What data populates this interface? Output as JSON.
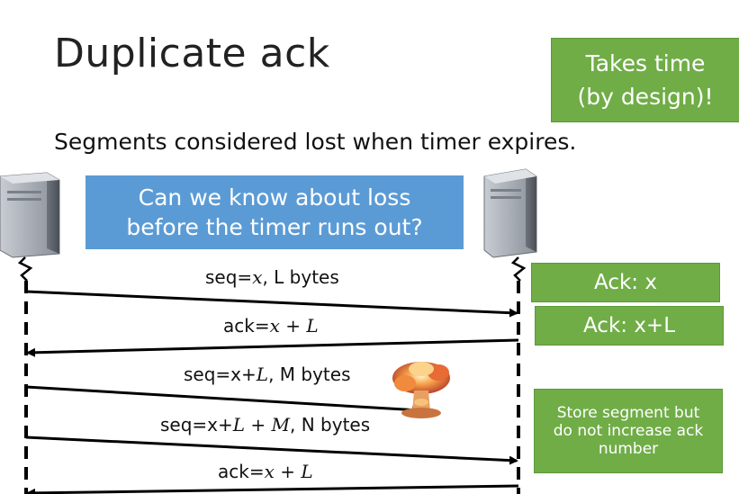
{
  "title": "Duplicate ack",
  "subtitle": "Segments considered lost when timer expires.",
  "callout_top": {
    "line1": "Takes time",
    "line2": "(by design)!"
  },
  "question_box": {
    "line1": "Can we know about loss",
    "line2": "before the timer runs out?"
  },
  "messages": [
    {
      "pre": "seq=",
      "var": "x",
      "post": ", L bytes",
      "direction": "right"
    },
    {
      "pre": "ack=",
      "var": "x + L",
      "post": "",
      "direction": "left"
    },
    {
      "pre": "seq=x+",
      "var": "L",
      "post": ", M bytes",
      "direction": "right-lost"
    },
    {
      "pre": "seq=x+",
      "var": "L + M",
      "post": ", N bytes",
      "direction": "right"
    },
    {
      "pre": "ack=",
      "var": "x + L",
      "post": "",
      "direction": "left"
    }
  ],
  "receiver_notes": {
    "ack1": "Ack: x",
    "ack2": "Ack: x+L",
    "store": {
      "line1": "Store segment but",
      "line2": "do not increase ack",
      "line3": "number"
    }
  },
  "icons": {
    "sender": "server-icon",
    "receiver": "server-icon",
    "loss": "explosion-icon"
  },
  "colors": {
    "green": "#70ad47",
    "blue": "#5b9bd5",
    "arrow": "#000000"
  }
}
